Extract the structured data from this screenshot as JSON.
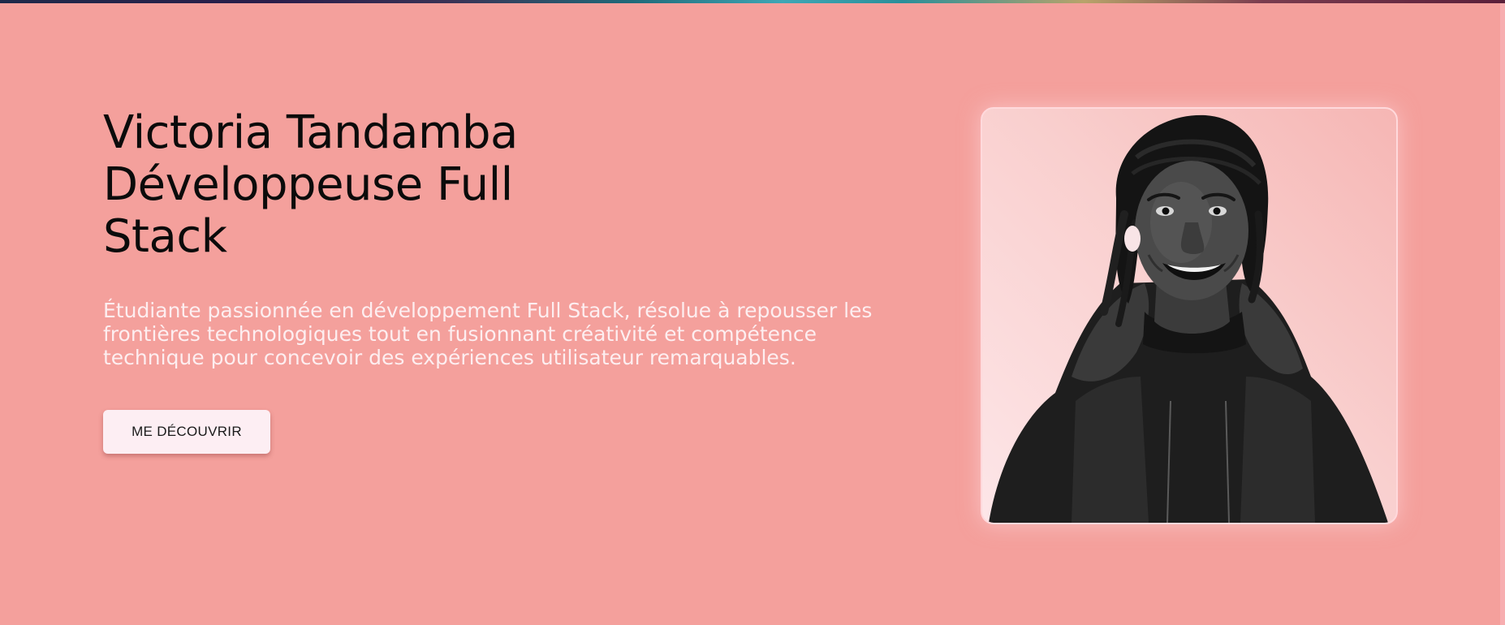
{
  "hero": {
    "title_lines": [
      "Victoria Tandamba",
      "Développeuse Full",
      "Stack"
    ],
    "description": "Étudiante passionnée en développement Full Stack, résolue à repousser les frontières technologiques tout en fusionnant créativité et compétence technique pour concevoir des expériences utilisateur remarquables.",
    "cta_label": "ME DÉCOUVRIR"
  },
  "portrait": {
    "alt": "Victoria Tandamba"
  },
  "colors": {
    "background": "#f4a09c",
    "button_background": "#fdeef3",
    "description_text": "#fdeef0",
    "title_text": "#0b0b0b"
  }
}
